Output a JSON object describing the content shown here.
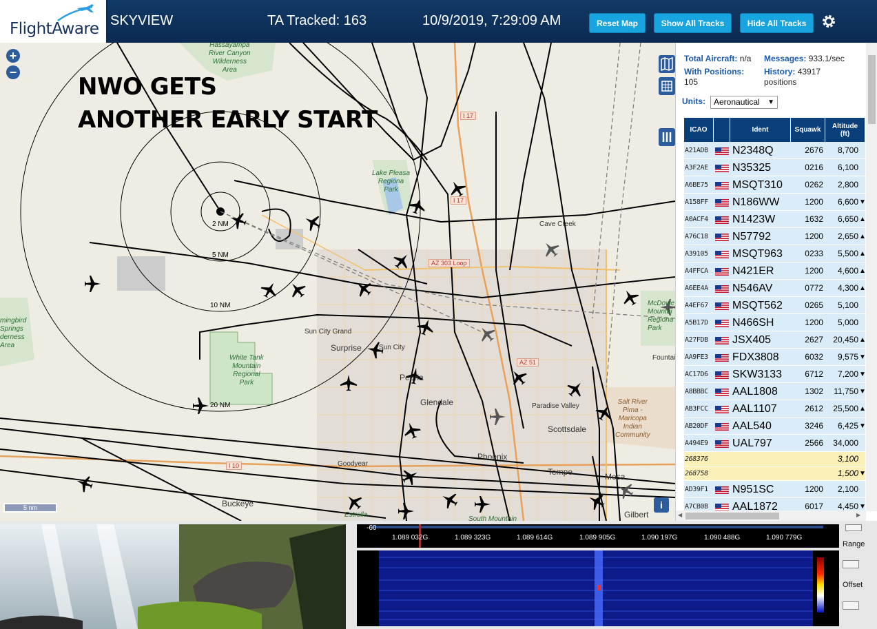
{
  "header": {
    "logo_text": "FlightAware",
    "app_name": "SKYVIEW",
    "tracked": "TA Tracked: 163",
    "datetime": "10/9/2019, 7:29:09 AM",
    "buttons": {
      "reset": "Reset Map",
      "show": "Show All Tracks",
      "hide": "Hide All Tracks"
    },
    "settings_icon": "gear-icon"
  },
  "map": {
    "headline_line1": "NWO GETS",
    "headline_line2": "ANOTHER EARLY START",
    "zoom_in": "+",
    "zoom_out": "−",
    "range_rings": [
      "2 NM",
      "5 NM",
      "10 NM",
      "20 NM"
    ],
    "scale": "5 nm",
    "info": "i",
    "places": {
      "cave_creek": "Cave Creek",
      "sun_city_grand": "Sun City Grand",
      "surprise": "Surprise",
      "sun_city": "Sun City",
      "peoria": "Peoria",
      "glendale": "Glendale",
      "paradise_valley": "Paradise Valley",
      "scottsdale": "Scottsdale",
      "phoenix": "Phoenix",
      "tempe": "Tempe",
      "mesa": "Mesa",
      "goodyear": "Goodyear",
      "buckeye": "Buckeye",
      "gilbert": "Gilbert",
      "estrella": "Estrella",
      "south_mountain": "South Mountain",
      "fountain": "Fountai"
    },
    "parks": {
      "hassayampa": "Hassayampa\nRiver Canyon\nWilderness\nArea",
      "lake_pleasant": "Lake Pleasa\nRegiona\nPark",
      "hummingbird": "mingbird\nSprings\nderness\nArea",
      "white_tank": "White Tank\nMountain\nRegional\nPark",
      "mcdowell": "McDowe\nMountai\nRegiona\nPark",
      "salt_river": "Salt River\nPima -\nMaricopa\nIndian\nCommunity"
    },
    "highways": {
      "i17": "I 17",
      "i17b": "I 17",
      "loop303": "AZ 303 Loop",
      "az51": "AZ 51",
      "i10": "I 10"
    }
  },
  "panel": {
    "total_aircraft_label": "Total Aircraft:",
    "total_aircraft": "n/a",
    "messages_label": "Messages:",
    "messages": "933.1/sec",
    "with_positions_label": "With Positions:",
    "with_positions": "105",
    "history_label": "History:",
    "history": "43917",
    "history_unit": "positions",
    "units_label": "Units:",
    "units_value": "Aeronautical",
    "columns": {
      "icao": "ICAO",
      "flag": "",
      "ident": "Ident",
      "squawk": "Squawk",
      "altitude": "Altitude\n(ft)"
    },
    "rows": [
      {
        "icao": "A21ADB",
        "ident": "N2348Q",
        "squawk": "2676",
        "alt": "8,700",
        "trend": ""
      },
      {
        "icao": "A3F2AE",
        "ident": "N35325",
        "squawk": "0216",
        "alt": "6,100",
        "trend": ""
      },
      {
        "icao": "A6BE75",
        "ident": "MSQT310",
        "squawk": "0262",
        "alt": "2,800",
        "trend": ""
      },
      {
        "icao": "A158FF",
        "ident": "N186WW",
        "squawk": "1200",
        "alt": "6,600",
        "trend": "▼"
      },
      {
        "icao": "A0ACF4",
        "ident": "N1423W",
        "squawk": "1632",
        "alt": "6,650",
        "trend": "▲"
      },
      {
        "icao": "A76C18",
        "ident": "N57792",
        "squawk": "1200",
        "alt": "2,650",
        "trend": "▲"
      },
      {
        "icao": "A39105",
        "ident": "MSQT963",
        "squawk": "0233",
        "alt": "5,500",
        "trend": "▲"
      },
      {
        "icao": "A4FFCA",
        "ident": "N421ER",
        "squawk": "1200",
        "alt": "4,600",
        "trend": "▲"
      },
      {
        "icao": "A6EE4A",
        "ident": "N546AV",
        "squawk": "0772",
        "alt": "4,300",
        "trend": "▲"
      },
      {
        "icao": "A4EF67",
        "ident": "MSQT562",
        "squawk": "0265",
        "alt": "5,100",
        "trend": ""
      },
      {
        "icao": "A5B17D",
        "ident": "N466SH",
        "squawk": "1200",
        "alt": "5,000",
        "trend": ""
      },
      {
        "icao": "A27FDB",
        "ident": "JSX405",
        "squawk": "2627",
        "alt": "20,450",
        "trend": "▲"
      },
      {
        "icao": "AA9FE3",
        "ident": "FDX3808",
        "squawk": "6032",
        "alt": "9,575",
        "trend": "▼"
      },
      {
        "icao": "AC17D6",
        "ident": "SKW3133",
        "squawk": "6712",
        "alt": "7,200",
        "trend": "▼"
      },
      {
        "icao": "A8BBBC",
        "ident": "AAL1808",
        "squawk": "1302",
        "alt": "11,750",
        "trend": "▼"
      },
      {
        "icao": "AB3FCC",
        "ident": "AAL1107",
        "squawk": "2612",
        "alt": "25,500",
        "trend": "▲"
      },
      {
        "icao": "AB20DF",
        "ident": "AAL540",
        "squawk": "3246",
        "alt": "6,425",
        "trend": "▼"
      },
      {
        "icao": "A494E9",
        "ident": "UAL797",
        "squawk": "2566",
        "alt": "34,000",
        "trend": ""
      },
      {
        "icao": "268376",
        "ident": "",
        "squawk": "",
        "alt": "3,100",
        "trend": "",
        "yellow": true
      },
      {
        "icao": "268758",
        "ident": "",
        "squawk": "",
        "alt": "1,500",
        "trend": "▼",
        "yellow": true
      },
      {
        "icao": "AD39F1",
        "ident": "N951SC",
        "squawk": "1200",
        "alt": "2,100",
        "trend": ""
      },
      {
        "icao": "A7CB0B",
        "ident": "AAL1872",
        "squawk": "6017",
        "alt": "4,450",
        "trend": "▼"
      }
    ]
  },
  "sdr": {
    "db_label": "-60",
    "freq_ticks": [
      "1.089 032G",
      "1.089 323G",
      "1.089 614G",
      "1.089 905G",
      "1.090 197G",
      "1.090 488G",
      "1.090 779G"
    ],
    "range_label": "Range",
    "offset_label": "Offset"
  },
  "colors": {
    "header_bg": "#0b2a52",
    "button": "#18a4de",
    "table_header": "#0b3f7a",
    "row_bg": "#d9ecf8",
    "row_yellow": "#fbf1b8"
  }
}
